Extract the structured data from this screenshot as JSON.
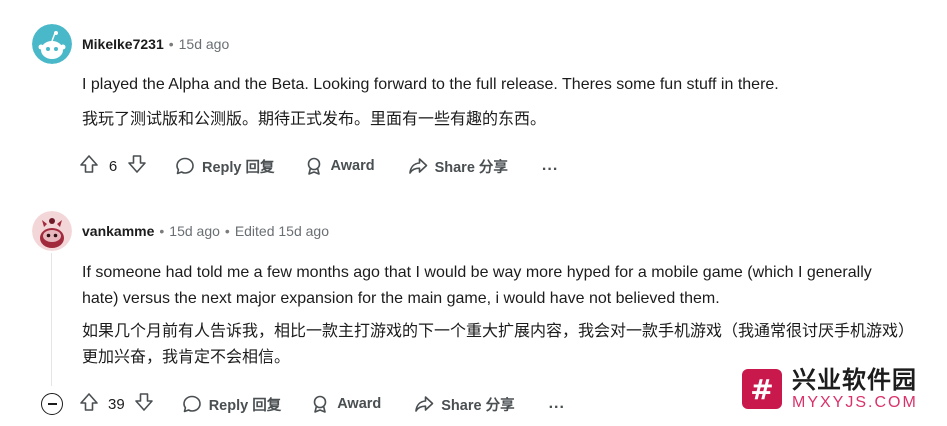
{
  "comments": [
    {
      "username": "MikeIke7231",
      "time": "15d ago",
      "edited": "",
      "body_en": "I played the Alpha and the Beta. Looking forward to the full release. Theres some fun stuff in there.",
      "body_zh": "我玩了测试版和公测版。期待正式发布。里面有一些有趣的东西。",
      "votes": "6",
      "reply_label": "Reply 回复",
      "award_label": "Award",
      "share_label": "Share 分享",
      "more_label": "..."
    },
    {
      "username": "vankamme",
      "time": "15d ago",
      "edited": "Edited 15d ago",
      "body_en": "If someone had told me a few months ago that I would be way more hyped for a mobile game (which I generally hate) versus the next major expansion for the main game, i would have not believed them.",
      "body_zh": "如果几个月前有人告诉我，相比一款主打游戏的下一个重大扩展内容，我会对一款手机游戏（我通常很讨厌手机游戏）更加兴奋，我肯定不会相信。",
      "votes": "39",
      "reply_label": "Reply 回复",
      "award_label": "Award",
      "share_label": "Share 分享",
      "more_label": "..."
    }
  ],
  "separator": "•",
  "watermark": {
    "logo_glyph": "#",
    "title": "兴业软件园",
    "url": "MYXYJS.COM"
  },
  "colors": {
    "avatar1_bg": "#49b8c8",
    "avatar2_bg": "#f3d6d8",
    "watermark_brand": "#c8184c"
  }
}
